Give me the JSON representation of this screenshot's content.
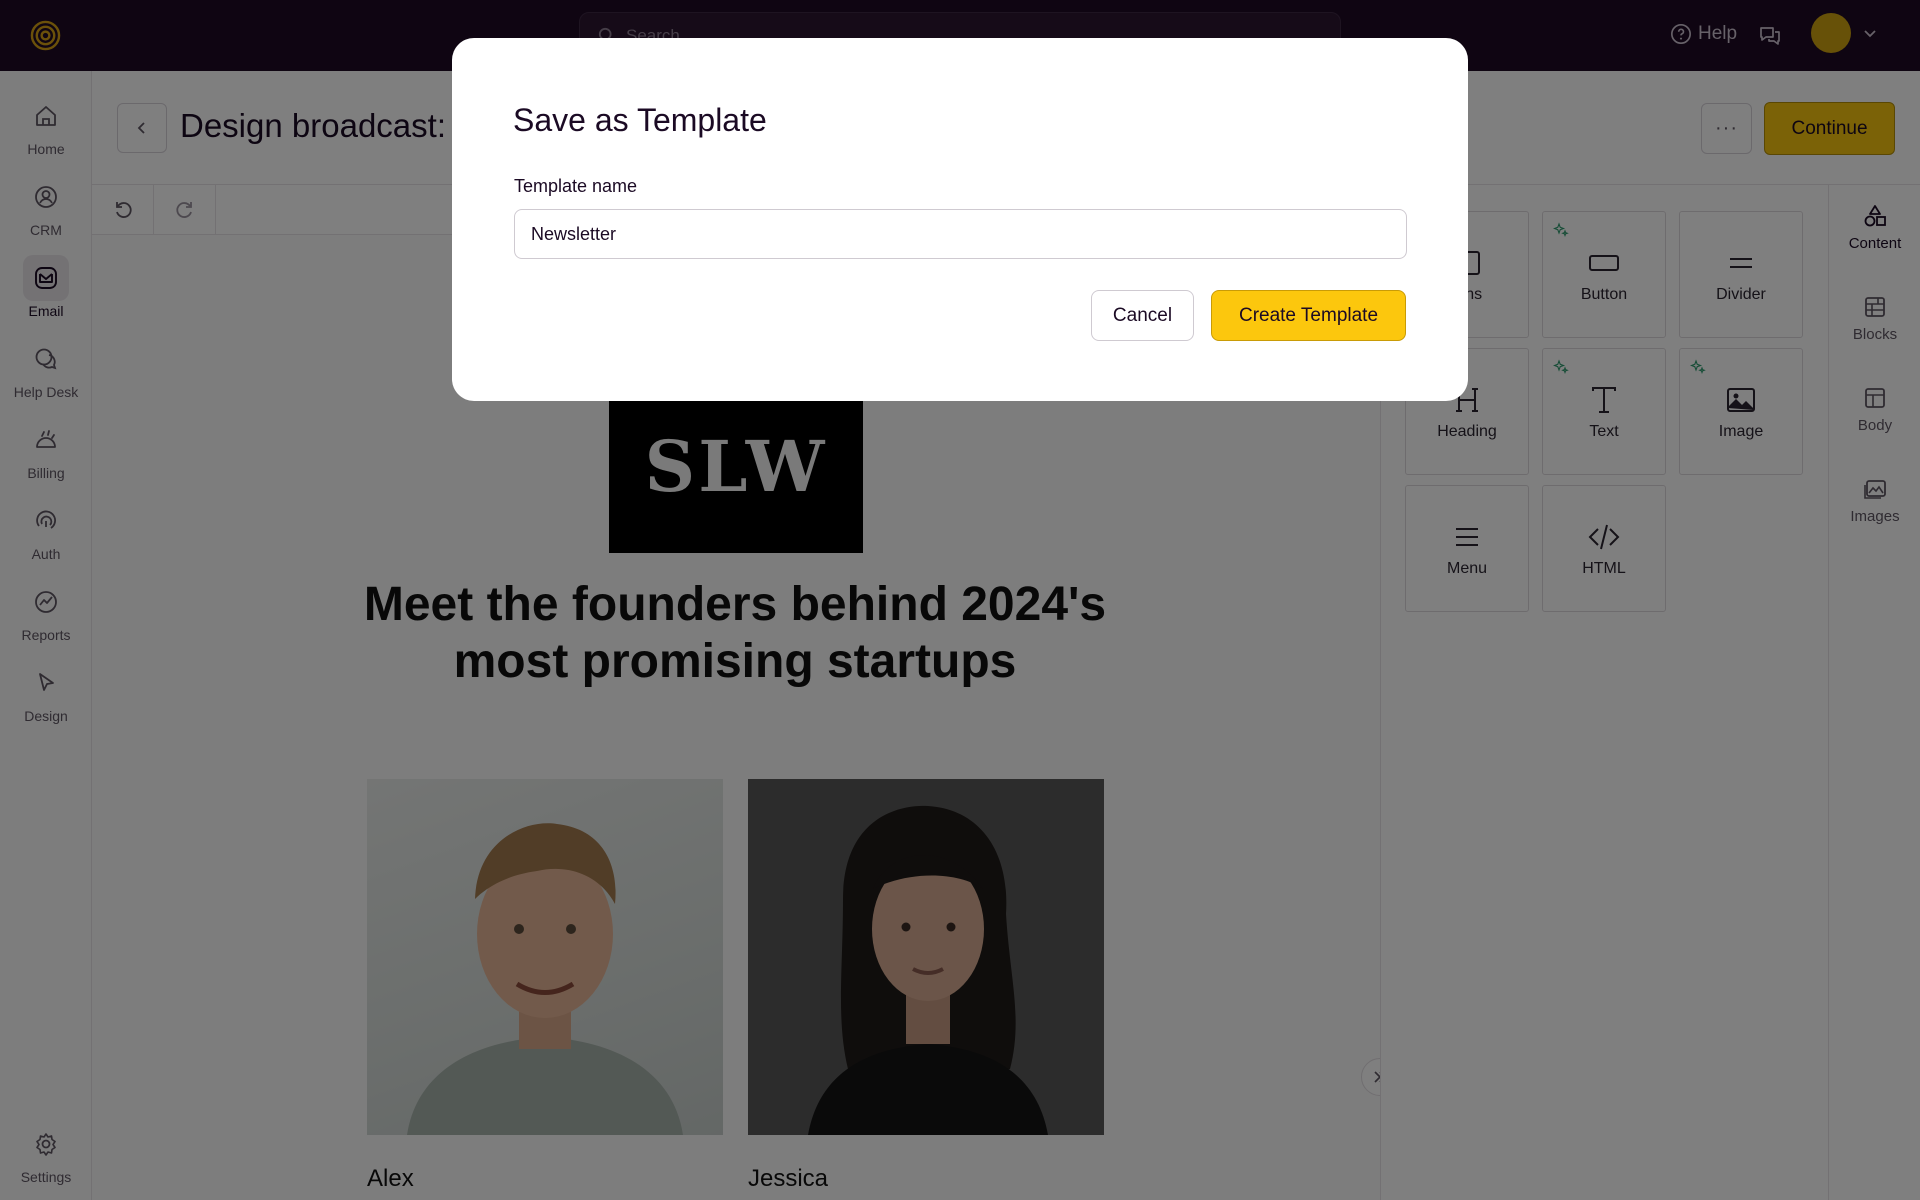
{
  "topbar": {
    "search_placeholder": "Search",
    "help_label": "Help"
  },
  "sidebar": {
    "items": [
      {
        "label": "Home",
        "icon": "home-icon"
      },
      {
        "label": "CRM",
        "icon": "crm-icon"
      },
      {
        "label": "Email",
        "icon": "email-icon",
        "active": true
      },
      {
        "label": "Help Desk",
        "icon": "help-desk-icon"
      },
      {
        "label": "Billing",
        "icon": "billing-icon"
      },
      {
        "label": "Auth",
        "icon": "auth-icon"
      },
      {
        "label": "Reports",
        "icon": "reports-icon"
      },
      {
        "label": "Design",
        "icon": "design-icon"
      }
    ],
    "settings_label": "Settings"
  },
  "header": {
    "title": "Design broadcast: N",
    "more_label": "···",
    "continue_label": "Continue"
  },
  "email": {
    "logo_text": "SLW",
    "headline": "Meet the founders behind 2024's most promising startups",
    "people": [
      {
        "name": "Alex"
      },
      {
        "name": "Jessica"
      }
    ]
  },
  "panel": {
    "tiles": [
      {
        "label": "mns",
        "icon": "columns-icon",
        "ai": false
      },
      {
        "label": "Button",
        "icon": "button-icon",
        "ai": true
      },
      {
        "label": "Divider",
        "icon": "divider-icon",
        "ai": false
      },
      {
        "label": "Heading",
        "icon": "heading-icon",
        "ai": false
      },
      {
        "label": "Text",
        "icon": "text-icon",
        "ai": true
      },
      {
        "label": "Image",
        "icon": "image-icon",
        "ai": true
      },
      {
        "label": "Menu",
        "icon": "menu-icon",
        "ai": false
      },
      {
        "label": "HTML",
        "icon": "html-icon",
        "ai": false
      }
    ],
    "rail": [
      {
        "label": "Content",
        "icon": "content-icon",
        "active": true
      },
      {
        "label": "Blocks",
        "icon": "blocks-icon"
      },
      {
        "label": "Body",
        "icon": "body-icon"
      },
      {
        "label": "Images",
        "icon": "images-icon"
      }
    ]
  },
  "modal": {
    "title": "Save as Template",
    "field_label": "Template name",
    "field_value": "Newsletter",
    "cancel_label": "Cancel",
    "create_label": "Create Template"
  },
  "colors": {
    "topbar": "#1f0a24",
    "accent": "#fcc70d",
    "ai_sparkle": "#2e9a6e"
  }
}
